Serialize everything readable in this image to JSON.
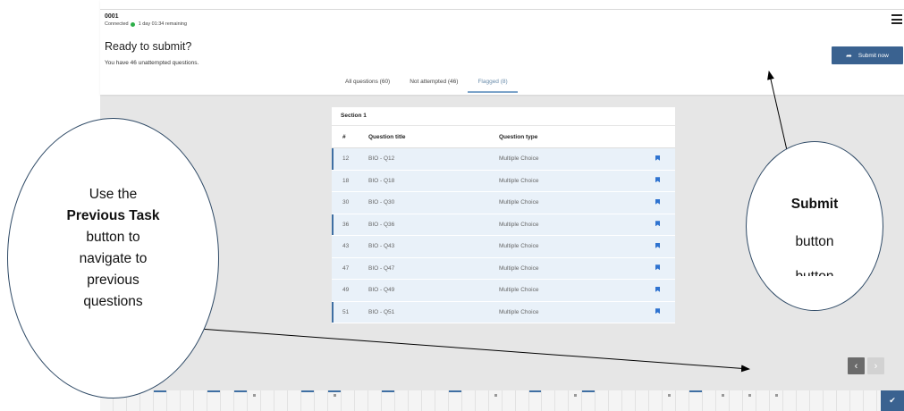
{
  "header": {
    "session_id": "0001",
    "status": "Connected",
    "time_remaining": "1 day 01:34 remaining",
    "title": "Ready to submit?",
    "note": "You have 46 unattempted questions.",
    "submit_label": "Submit now"
  },
  "tabs": [
    {
      "label": "All questions (60)",
      "active": false
    },
    {
      "label": "Not attempted (46)",
      "active": false
    },
    {
      "label": "Flagged (8)",
      "active": true
    }
  ],
  "table": {
    "section": "Section 1",
    "headers": {
      "num": "#",
      "title": "Question title",
      "type": "Question type"
    },
    "rows": [
      {
        "num": "12",
        "title": "BIO - Q12",
        "type": "Multiple Choice"
      },
      {
        "num": "18",
        "title": "BIO - Q18",
        "type": "Multiple Choice"
      },
      {
        "num": "30",
        "title": "BIO - Q30",
        "type": "Multiple Choice"
      },
      {
        "num": "36",
        "title": "BIO - Q36",
        "type": "Multiple Choice"
      },
      {
        "num": "43",
        "title": "BIO - Q43",
        "type": "Multiple Choice"
      },
      {
        "num": "47",
        "title": "BIO - Q47",
        "type": "Multiple Choice"
      },
      {
        "num": "49",
        "title": "BIO - Q49",
        "type": "Multiple Choice"
      },
      {
        "num": "51",
        "title": "BIO - Q51",
        "type": "Multiple Choice"
      }
    ]
  },
  "navigation": {
    "prev_icon": "chevron-left-icon",
    "next_icon": "chevron-right-icon"
  },
  "question_bar": {
    "count": 60,
    "answered": [
      1,
      5,
      9,
      11,
      16,
      18,
      22,
      27,
      33,
      37,
      45
    ],
    "flagged": [
      12,
      18,
      30,
      36,
      43,
      47,
      49,
      51
    ]
  },
  "annotations": {
    "left_lines": [
      "Use the",
      "Previous Task",
      "button to",
      "navigate to",
      "previous",
      "questions"
    ],
    "right_strong": "Submit",
    "right_text": "button",
    "right_cut": "button"
  },
  "colors": {
    "accent": "#3a6290",
    "flag": "#2f73d0",
    "row_bg": "#e9f1f9",
    "status_green": "#2eaf4a"
  }
}
